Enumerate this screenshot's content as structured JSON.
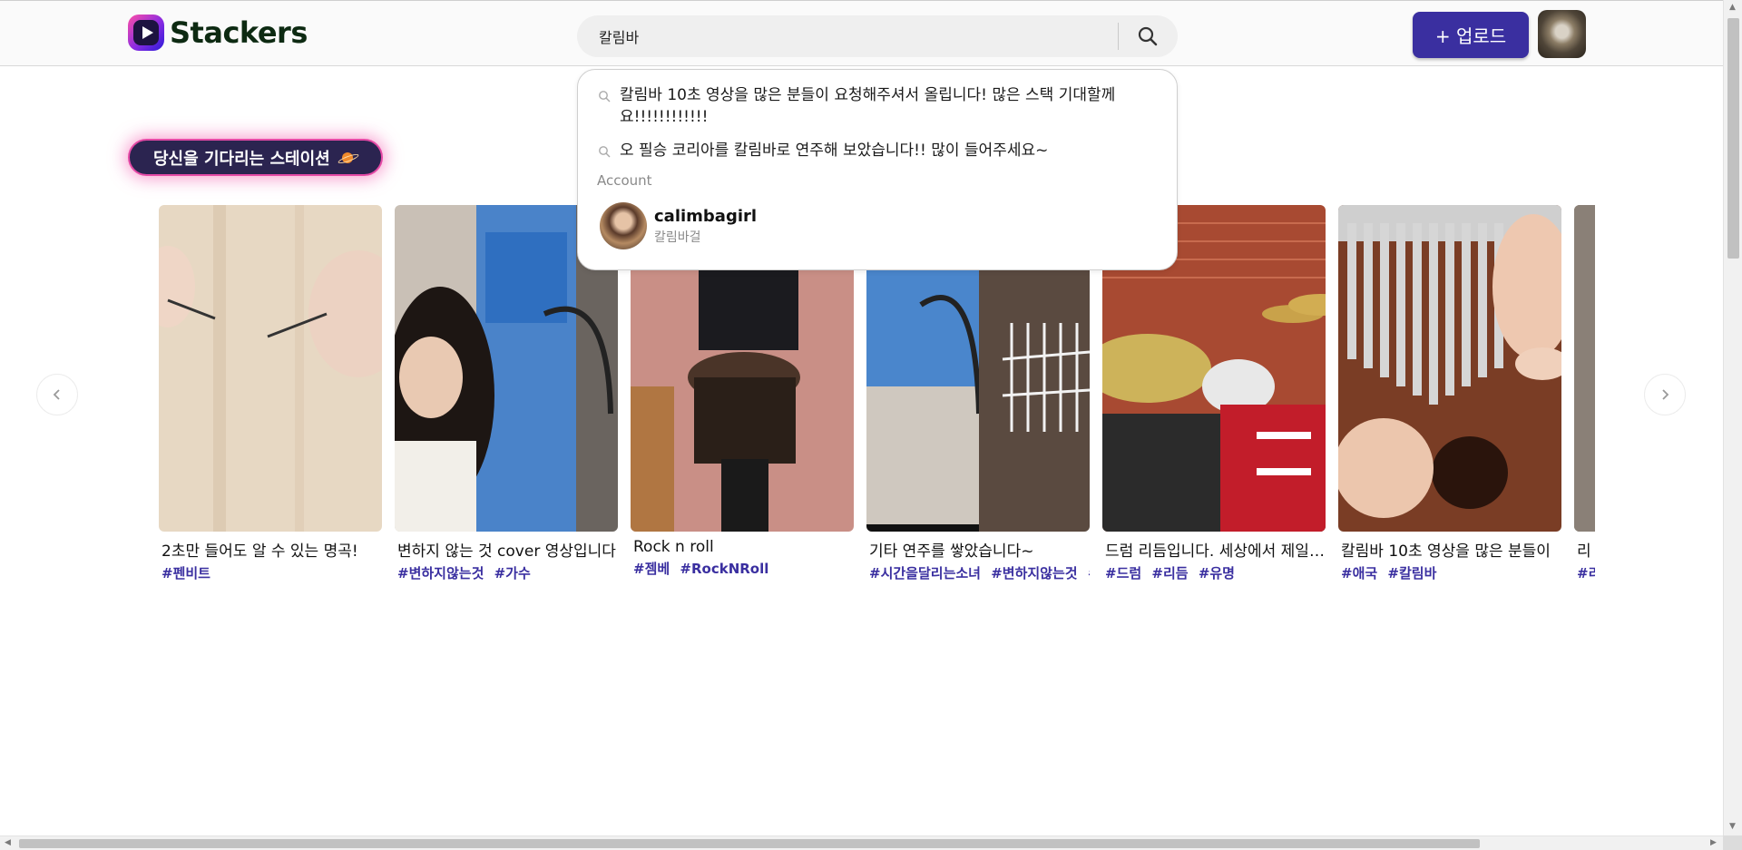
{
  "app": {
    "logo_text": "Stackers",
    "brand_color": "#3a2fa0",
    "accent_pink": "#e54aa6"
  },
  "header": {
    "search_value": "칼림바",
    "search_icon": "search-icon",
    "upload_label": "+ 업로드"
  },
  "dropdown": {
    "suggestions": [
      "칼림바 10초 영상을 많은 분들이 요청해주셔서 올립니다! 많은 스택 기대할께요!!!!!!!!!!!!",
      "오 필승 코리아를 칼림바로 연주해 보았습니다!! 많이 들어주세요~"
    ],
    "account_section_label": "Account",
    "account": {
      "username": "calimbagirl",
      "display_name": "칼림바걸"
    }
  },
  "section": {
    "title": "당신을 기다리는 스테이션"
  },
  "cards": [
    {
      "title": "2초만 들어도 알 수 있는 명곡!",
      "tags": [
        "#펜비트"
      ]
    },
    {
      "title": "변하지 않는 것 cover 영상입니다",
      "tags": [
        "#변하지않는것",
        "#가수"
      ]
    },
    {
      "title": "Rock n roll",
      "tags": [
        "#젬베",
        "#RockNRoll"
      ]
    },
    {
      "title": "기타 연주를 쌓았습니다~",
      "tags": [
        "#시간을달리는소녀",
        "#변하지않는것",
        "#"
      ]
    },
    {
      "title": "드럼 리듬입니다. 세상에서 제일 멋진",
      "tags": [
        "#드럼",
        "#리듬",
        "#유명"
      ]
    },
    {
      "title": "칼림바 10초 영상을 많은 분들이",
      "tags": [
        "#애국",
        "#칼림바"
      ]
    },
    {
      "title": "리",
      "tags": [
        "#리"
      ]
    }
  ],
  "navigation": {
    "prev_icon": "chevron-left-icon",
    "next_icon": "chevron-right-icon"
  }
}
